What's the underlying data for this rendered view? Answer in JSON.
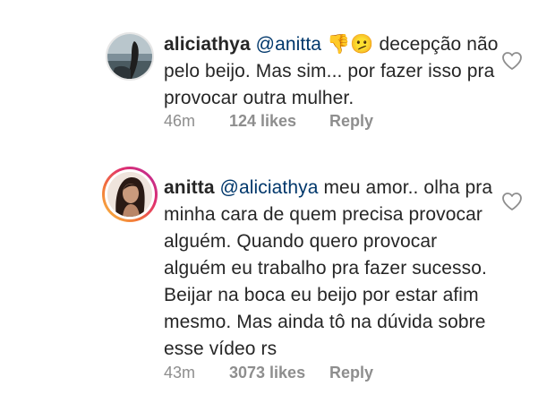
{
  "comments": [
    {
      "username": "aliciathya",
      "mention": "@anitta",
      "emoji": "👎🫤",
      "text": "decepção não pelo beijo. Mas sim... por fazer isso pra provocar outra mulher.",
      "time": "46m",
      "likes": "124 likes",
      "reply_label": "Reply",
      "avatar_icon": "user-photo-avatar",
      "like_icon": "heart-outline-icon"
    },
    {
      "username": "anitta",
      "mention": "@aliciathya",
      "text": "meu amor.. olha pra minha cara de quem precisa provocar alguém. Quando quero provocar alguém eu trabalho pra fazer sucesso. Beijar na boca eu beijo por estar afim mesmo. Mas ainda tô na dúvida sobre esse vídeo rs",
      "time": "43m",
      "likes": "3073 likes",
      "reply_label": "Reply",
      "avatar_icon": "story-ring-avatar",
      "like_icon": "heart-outline-icon"
    }
  ],
  "colors": {
    "text": "#262626",
    "mention": "#00376b",
    "meta": "#8e8e8e",
    "story_ring": [
      "#f9c543",
      "#f2733a",
      "#e0306e",
      "#b62c9c"
    ]
  }
}
